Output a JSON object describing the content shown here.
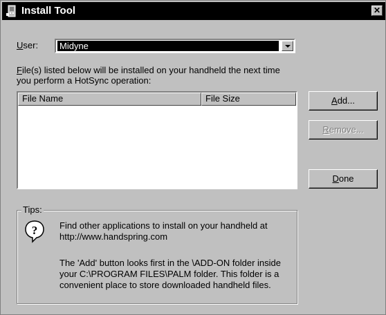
{
  "window": {
    "title": "Install Tool",
    "close_glyph": "✕"
  },
  "user": {
    "label": "User:",
    "value": "Midyne"
  },
  "instructions": [
    "File(s) listed below will be installed on your handheld the next time",
    "you perform a HotSync operation:"
  ],
  "file_list": {
    "columns": [
      "File Name",
      "File Size"
    ],
    "rows": []
  },
  "buttons": {
    "add": "Add...",
    "remove": "Remove...",
    "done": "Done"
  },
  "tips": {
    "title": "Tips:",
    "lines": [
      "Find other applications to install on your handheld at",
      "http://www.handspring.com",
      "The 'Add' button looks first in the \\ADD-ON folder inside",
      "your C:\\PROGRAM FILES\\PALM folder. This folder is a",
      "convenient place to store downloaded handheld files."
    ]
  },
  "icons": {
    "app": "handheld-icon",
    "help": "question-bubble-icon",
    "close": "close-icon",
    "dropdown": "chevron-down-icon"
  },
  "colors": {
    "face": "#c0c0c0",
    "titlebar": "#000000",
    "selection": "#000000",
    "disabled_text": "#808080"
  }
}
